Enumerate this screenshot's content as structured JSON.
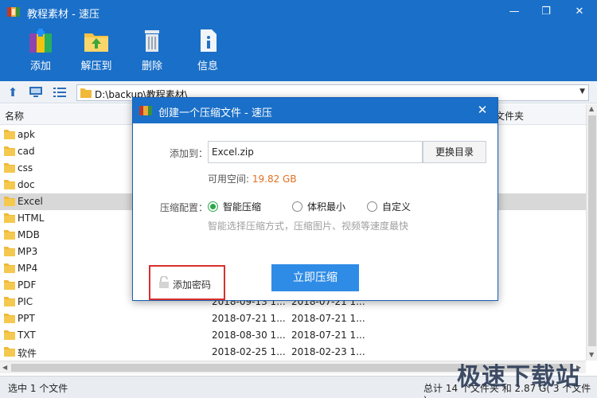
{
  "window": {
    "title": "教程素材 - 速压",
    "minimize": "—",
    "restore": "❐",
    "close": "✕"
  },
  "toolbar": {
    "add": "添加",
    "extract": "解压到",
    "delete": "删除",
    "info": "信息"
  },
  "address": {
    "path": "D:\\backup\\教程素材\\"
  },
  "list": {
    "columns": {
      "name": "名称",
      "type_partial": "文件夹"
    },
    "rows": [
      {
        "name": "apk",
        "d1": "",
        "d2": ""
      },
      {
        "name": "cad",
        "d1": "",
        "d2": ""
      },
      {
        "name": "css",
        "d1": "",
        "d2": ""
      },
      {
        "name": "doc",
        "d1": "",
        "d2": ""
      },
      {
        "name": "Excel",
        "d1": "",
        "d2": ""
      },
      {
        "name": "HTML",
        "d1": "",
        "d2": ""
      },
      {
        "name": "MDB",
        "d1": "",
        "d2": ""
      },
      {
        "name": "MP3",
        "d1": "",
        "d2": ""
      },
      {
        "name": "MP4",
        "d1": "",
        "d2": ""
      },
      {
        "name": "PDF",
        "d1": "",
        "d2": ""
      },
      {
        "name": "PIC",
        "d1": "2018-09-13 1...",
        "d2": "2018-07-21 1..."
      },
      {
        "name": "PPT",
        "d1": "2018-07-21 1...",
        "d2": "2018-07-21 1..."
      },
      {
        "name": "TXT",
        "d1": "2018-08-30 1...",
        "d2": "2018-07-21 1..."
      },
      {
        "name": "软件",
        "d1": "2018-02-25 1...",
        "d2": "2018-02-23 1..."
      }
    ]
  },
  "status": {
    "left": "选中 1 个文件",
    "right": "总计 14 个文件夹 和 2.87 G( 3 个文件 )"
  },
  "watermark": "极速下载站",
  "dialog": {
    "title": "创建一个压缩文件 - 速压",
    "close": "✕",
    "add_to_label": "添加到：",
    "filename": "Excel.zip",
    "change_dir": "更换目录",
    "free_space_label": "可用空间: ",
    "free_space_value": "19.82 GB",
    "config_label": "压缩配置：",
    "options": [
      "智能压缩",
      "体积最小",
      "自定义"
    ],
    "selected_option": "智能压缩",
    "hint": "智能选择压缩方式，压缩图片、视频等速度最快",
    "add_password": "添加密码",
    "compress_now": "立即压缩"
  },
  "colors": {
    "titlebar": "#1a6fc8",
    "accent_button": "#2e8be6",
    "free_space": "#e0701f",
    "radio_selected": "#2aa84a",
    "highlight_box": "#d9302c"
  }
}
